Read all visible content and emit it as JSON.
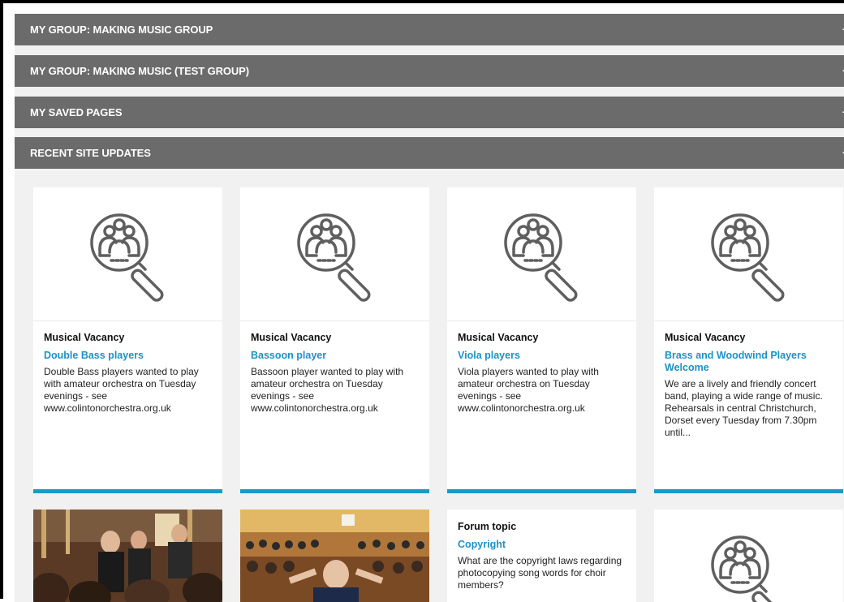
{
  "groups": [
    {
      "label": "MY GROUP: MAKING MUSIC GROUP",
      "toggle": "+"
    },
    {
      "label": "MY GROUP: MAKING MUSIC (TEST GROUP)",
      "toggle": "+"
    },
    {
      "label": "MY SAVED PAGES",
      "toggle": "+"
    },
    {
      "label": "RECENT SITE UPDATES",
      "toggle": "+"
    }
  ],
  "cards": [
    {
      "type": "Musical Vacancy",
      "title": "Double Bass players",
      "desc": "Double Bass players wanted to play with amateur orchestra on Tuesday evenings - see www.colintonorchestra.org.uk"
    },
    {
      "type": "Musical Vacancy",
      "title": "Bassoon player",
      "desc": "Bassoon player wanted to play with amateur orchestra on Tuesday evenings - see www.colintonorchestra.org.uk"
    },
    {
      "type": "Musical Vacancy",
      "title": "Viola players",
      "desc": "Viola players wanted to play with amateur orchestra on Tuesday evenings - see www.colintonorchestra.org.uk"
    },
    {
      "type": "Musical Vacancy",
      "title": "Brass and Woodwind Players Welcome",
      "desc": "We are a lively and friendly concert band, playing a wide range of music. Rehearsals in central Christchurch, Dorset every Tuesday from 7.30pm until..."
    }
  ],
  "row2": {
    "forum": {
      "type": "Forum topic",
      "title": "Copyright",
      "desc": "What are the copyright laws regarding photocopying song words for choir members?"
    }
  },
  "colors": {
    "bar": "#6b6b6b",
    "accent": "#1a98cc",
    "link": "#1a93c7"
  },
  "icons": {
    "placeholder": "group-search-icon"
  }
}
